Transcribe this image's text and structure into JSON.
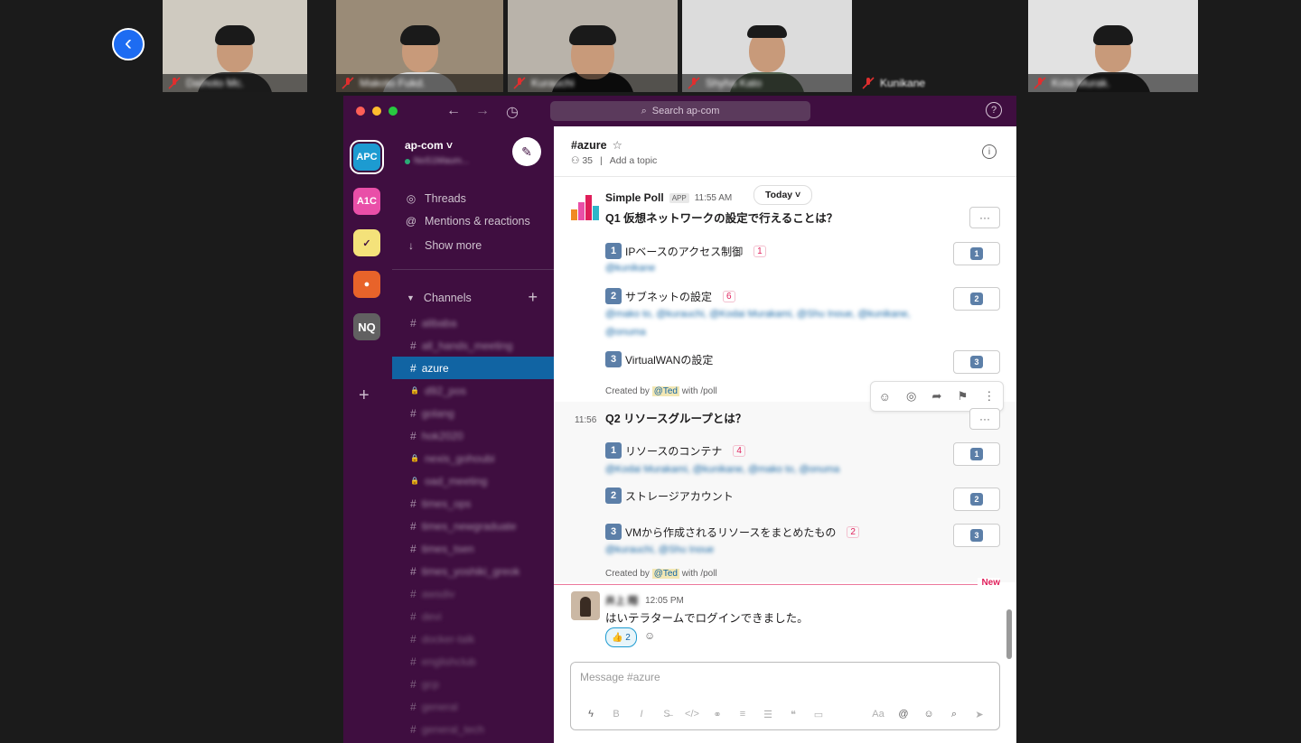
{
  "zoom": {
    "back_label": "‹",
    "participants": [
      {
        "name": "Daihoto Mc.",
        "shirt": "#3a3a3a",
        "bg": "#cfcac0"
      },
      {
        "name": "Makoto Fukd.",
        "shirt": "#d8d8d8",
        "bg": "#9a8b77"
      },
      {
        "name": "Kurauchi",
        "shirt": "#1a1a1a",
        "bg": "#b9b3aa"
      },
      {
        "name": "Shyha Kato",
        "shirt": "#5d6e5a",
        "bg": "#dcdcdc"
      },
      {
        "name": "Kunikane",
        "shirt": "#1b1b1b",
        "bg": "#1b1b1b"
      },
      {
        "name": "Kota Murak.",
        "shirt": "#2a2a2a",
        "bg": "#e2e2e2"
      }
    ]
  },
  "slack": {
    "search_placeholder": "Search ap-com",
    "workspace": {
      "name": "ap-com ˅",
      "status": "NoS1Maum..."
    },
    "rail": [
      {
        "label": "APC",
        "color": "#1d9bd1"
      },
      {
        "label": "A1C",
        "color": "#e94fa8"
      },
      {
        "label": "✓",
        "color": "#f4e27a"
      },
      {
        "label": "●",
        "color": "#e8632a"
      },
      {
        "label": "NQ",
        "color": "#616061"
      }
    ],
    "nav": [
      {
        "icon": "◎",
        "label": "Threads"
      },
      {
        "icon": "@",
        "label": "Mentions & reactions"
      },
      {
        "icon": "↓",
        "label": "Show more"
      }
    ],
    "channels_label": "Channels",
    "channels": [
      {
        "prefix": "#",
        "name": "alibaba"
      },
      {
        "prefix": "#",
        "name": "all_hands_meeting"
      },
      {
        "prefix": "#",
        "name": "azure",
        "active": true
      },
      {
        "prefix": "🔒",
        "name": "d92_pos"
      },
      {
        "prefix": "#",
        "name": "golang"
      },
      {
        "prefix": "#",
        "name": "hok2020"
      },
      {
        "prefix": "🔒",
        "name": "nexis_gohoubi"
      },
      {
        "prefix": "🔒",
        "name": "oad_meeting"
      },
      {
        "prefix": "#",
        "name": "times_ops"
      },
      {
        "prefix": "#",
        "name": "times_newgraduate"
      },
      {
        "prefix": "#",
        "name": "times_tsen"
      },
      {
        "prefix": "#",
        "name": "times_yoshiki_greok"
      },
      {
        "prefix": "#",
        "name": "awsdiv",
        "dim": true
      },
      {
        "prefix": "#",
        "name": "devi",
        "dim": true
      },
      {
        "prefix": "#",
        "name": "docker-talk",
        "dim": true
      },
      {
        "prefix": "#",
        "name": "englishclub",
        "dim": true
      },
      {
        "prefix": "#",
        "name": "gcp",
        "dim": true
      },
      {
        "prefix": "#",
        "name": "general",
        "dim": true
      },
      {
        "prefix": "#",
        "name": "general_tech",
        "dim": true
      }
    ],
    "channel": {
      "title": "#azure",
      "members": "35",
      "topic": "Add a topic"
    },
    "poll_msg": {
      "sender": "Simple Poll",
      "app_badge": "APP",
      "time": "11:55 AM",
      "day_divider": "Today ˅",
      "q1": {
        "question": "Q1 仮想ネットワークの設定で行えることは？",
        "options": [
          {
            "n": "1",
            "text": "IPベースのアクセス制御",
            "count": "1",
            "voters": "@kunikane"
          },
          {
            "n": "2",
            "text": "サブネットの設定",
            "count": "6",
            "voters": "@mako to, @kurauchi, @Kodai Murakami, @Shu Inoue, @kunikane, @onuma"
          },
          {
            "n": "3",
            "text": "VirtualWANの設定",
            "count": "",
            "voters": ""
          }
        ],
        "created_prefix": "Created by",
        "created_user": "@Ted",
        "created_suffix": "with /poll"
      },
      "q2_time": "11:56",
      "q2": {
        "question": "Q2 リソースグループとは？",
        "options": [
          {
            "n": "1",
            "text": "リソースのコンテナ",
            "count": "4",
            "voters": "@Kodai Murakami, @kunikane, @mako to, @onuma"
          },
          {
            "n": "2",
            "text": "ストレージアカウント",
            "count": "",
            "voters": ""
          },
          {
            "n": "3",
            "text": "VMから作成されるリソースをまとめたもの",
            "count": "2",
            "voters": "@kurauchi, @Shu Inoue"
          }
        ],
        "created_prefix": "Created by",
        "created_user": "@Ted",
        "created_suffix": "with /poll"
      },
      "more_label": "···"
    },
    "new_label": "New",
    "reply": {
      "user": "井上 翔",
      "time": "12:05 PM",
      "text": "はいテラタームでログインできました。",
      "reaction": "👍 2"
    },
    "composer_placeholder": "Message #azure"
  }
}
